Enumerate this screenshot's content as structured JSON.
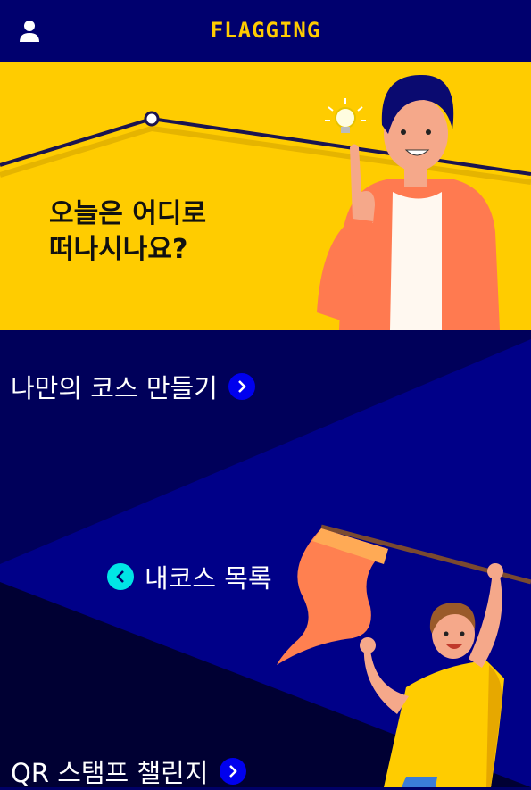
{
  "header": {
    "logo": "FLAGGING",
    "user_icon": "user-icon"
  },
  "hero": {
    "line1": "오늘은 어디로",
    "line2": "떠나시나요?"
  },
  "menu": {
    "make_course": "나만의 코스 만들기",
    "my_courses": "내코스 목록",
    "qr_challenge": "QR 스탬프 챌린지"
  },
  "colors": {
    "navy": "#000066",
    "yellow": "#ffcc00",
    "blue_button": "#0000ee",
    "cyan_button": "#00e5e5"
  }
}
